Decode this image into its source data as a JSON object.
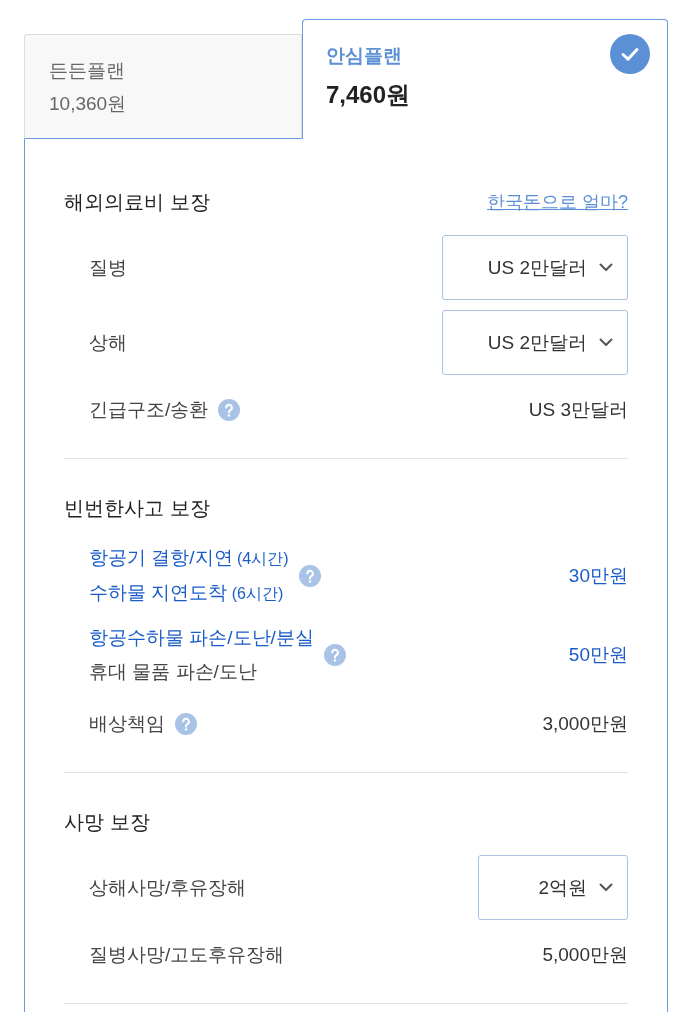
{
  "tabs": [
    {
      "title": "든든플랜",
      "price": "10,360원",
      "selected": false
    },
    {
      "title": "안심플랜",
      "price": "7,460원",
      "selected": true
    }
  ],
  "sections": [
    {
      "title": "해외의료비 보장",
      "link": "한국돈으로 얼마?",
      "rows": [
        {
          "lines": [
            {
              "text": "질병",
              "highlighted": false
            }
          ],
          "help": false,
          "value": {
            "kind": "select",
            "text": "US 2만달러",
            "highlighted": false
          }
        },
        {
          "lines": [
            {
              "text": "상해",
              "highlighted": false
            }
          ],
          "help": false,
          "value": {
            "kind": "select",
            "text": "US 2만달러",
            "highlighted": false
          }
        },
        {
          "lines": [
            {
              "text": "긴급구조/송환",
              "highlighted": false
            }
          ],
          "help": true,
          "value": {
            "kind": "text",
            "text": "US 3만달러",
            "highlighted": false
          }
        }
      ]
    },
    {
      "title": "빈번한사고 보장",
      "rows": [
        {
          "lines": [
            {
              "text": "항공기 결항/지연",
              "note": "(4시간)",
              "highlighted": true
            },
            {
              "text": "수하물 지연도착",
              "note": "(6시간)",
              "highlighted": true
            }
          ],
          "help": true,
          "value": {
            "kind": "text",
            "text": "30만원",
            "highlighted": true
          }
        },
        {
          "lines": [
            {
              "text": "항공수하물 파손/도난/분실",
              "highlighted": true
            },
            {
              "text": "휴대 물품 파손/도난",
              "highlighted": false
            }
          ],
          "help": true,
          "value": {
            "kind": "text",
            "text": "50만원",
            "highlighted": true
          }
        },
        {
          "lines": [
            {
              "text": "배상책임",
              "highlighted": false
            }
          ],
          "help": true,
          "value": {
            "kind": "text",
            "text": "3,000만원",
            "highlighted": false
          }
        }
      ]
    },
    {
      "title": "사망 보장",
      "rows": [
        {
          "lines": [
            {
              "text": "상해사망/후유장해",
              "highlighted": false
            }
          ],
          "help": false,
          "value": {
            "kind": "select",
            "text": "2억원",
            "highlighted": false
          }
        },
        {
          "lines": [
            {
              "text": "질병사망/고도후유장해",
              "highlighted": false
            }
          ],
          "help": false,
          "value": {
            "kind": "text",
            "text": "5,000만원",
            "highlighted": false
          }
        }
      ]
    }
  ]
}
